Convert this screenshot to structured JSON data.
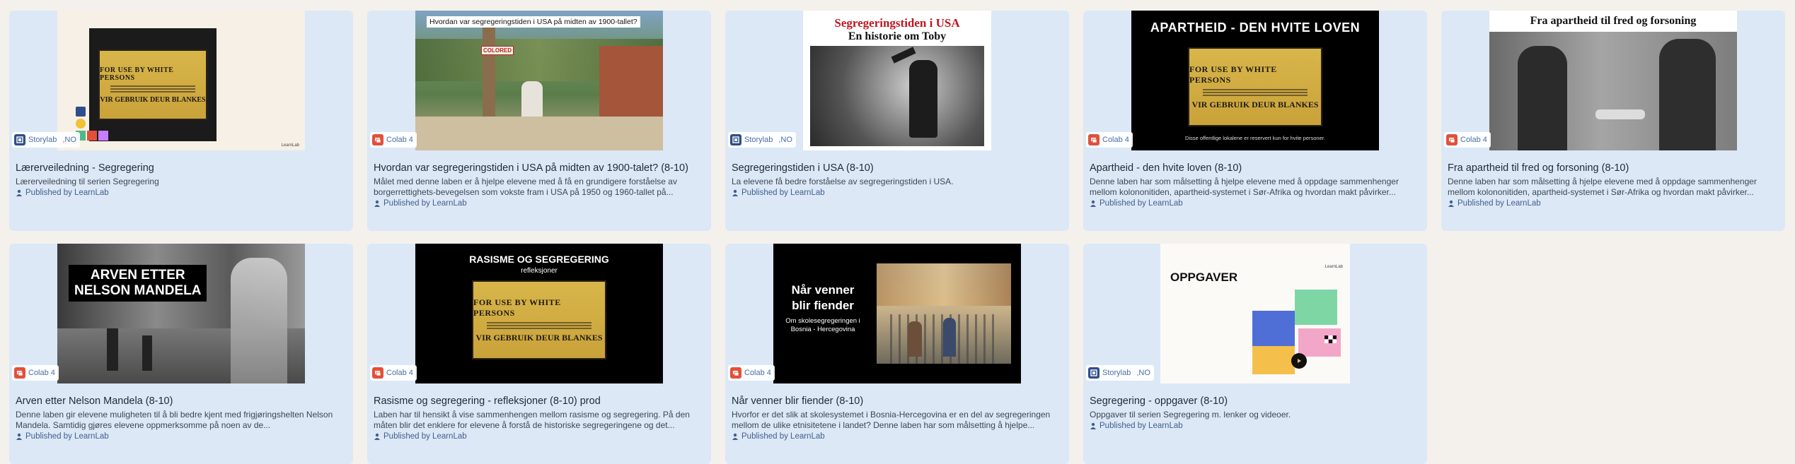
{
  "cards": [
    {
      "title": "Lærerveiledning - Segregering",
      "desc": "Lærerveiledning til serien Segregering",
      "publisher": "Published by LearnLab",
      "badge": "Storylab",
      "badge_lang": ",NO",
      "thumb": {
        "sign_top": "FOR USE BY WHITE PERSONS",
        "sign_bottom": "VIR GEBRUIK DEUR BLANKES",
        "corner": "LearnLab"
      }
    },
    {
      "title": "Hvordan var segregeringstiden i USA på midten av 1900-talet? (8-10)",
      "desc": "Målet med denne laben er å hjelpe elevene med å få en grundigere forståelse av borgerrettighets-bevegelsen som vokste fram i USA på 1950 og 1960-tallet på...",
      "publisher": "Published by LearnLab",
      "badge": "Colab 4",
      "thumb": {
        "caption": "Hvordan var segregeringstiden i USA på midten av 1900-tallet?",
        "sign": "COLORED"
      }
    },
    {
      "title": "Segregeringstiden i USA (8-10)",
      "desc": "La elevene få bedre forståelse av segregeringstiden i USA.",
      "publisher": "Published by LearnLab",
      "badge": "Storylab",
      "badge_lang": ",NO",
      "thumb": {
        "line1": "Segregeringstiden i USA",
        "line2": "En historie om Toby"
      }
    },
    {
      "title": "Apartheid - den hvite loven (8-10)",
      "desc": "Denne laben har som målsetting å hjelpe elevene med å oppdage sammenhenger mellom kolononitiden, apartheid-systemet i Sør-Afrika og hvordan makt påvirker...",
      "publisher": "Published by LearnLab",
      "badge": "Colab 4",
      "thumb": {
        "heading": "APARTHEID - DEN HVITE LOVEN",
        "sign_top": "FOR USE BY WHITE PERSONS",
        "sign_bottom": "VIR GEBRUIK DEUR BLANKES",
        "caption": "Disse offentlige lokalene er reservert kun for hvite personer."
      }
    },
    {
      "title": "Fra apartheid til fred og forsoning (8-10)",
      "desc": "Denne laben har som målsetting å hjelpe elevene med å oppdage sammenhenger mellom kolononitiden, apartheid-systemet i Sør-Afrika og hvordan makt påvirker...",
      "publisher": "Published by LearnLab",
      "badge": "Colab 4",
      "thumb": {
        "heading": "Fra apartheid til fred og forsoning"
      }
    },
    {
      "title": "Arven etter Nelson Mandela (8-10)",
      "desc": "Denne laben gir elevene muligheten til å bli bedre kjent med frigjøringshelten Nelson Mandela. Samtidig gjøres elevene oppmerksomme på noen av de...",
      "publisher": "Published by LearnLab",
      "badge": "Colab 4",
      "thumb": {
        "line1": "ARVEN ETTER",
        "line2": "NELSON MANDELA"
      }
    },
    {
      "title": "Rasisme og segregering - refleksjoner (8-10) prod",
      "desc": "Laben har til hensikt å vise sammenhengen mellom rasisme og segregering. På den måten blir det enklere for elevene å forstå de historiske segregeringene og det...",
      "publisher": "Published by LearnLab",
      "badge": "Colab 4",
      "thumb": {
        "heading": "RASISME OG SEGREGERING",
        "sub": "refleksjoner",
        "sign_top": "FOR USE BY WHITE PERSONS",
        "sign_bottom": "VIR GEBRUIK DEUR BLANKES"
      }
    },
    {
      "title": "Når venner blir fiender (8-10)",
      "desc": "Hvorfor er det slik at skolesystemet i Bosnia-Hercegovina er en del av segregeringen mellom de ulike etnisitetene i landet? Denne laben har som målsetting å hjelpe...",
      "publisher": "Published by LearnLab",
      "badge": "Colab 4",
      "thumb": {
        "line1": "Når venner",
        "line2": "blir fiender",
        "sub": "Om skolesegregeringen i Bosnia - Hercegovina"
      }
    },
    {
      "title": "Segregering - oppgaver (8-10)",
      "desc": "Oppgaver til serien Segregering m. lenker og videoer.",
      "publisher": "Published by LearnLab",
      "badge": "Storylab",
      "badge_lang": ",NO",
      "thumb": {
        "heading": "OPPGAVER",
        "corner": "LearnLab"
      }
    }
  ],
  "colors": {
    "card_bg": "#dce8f6",
    "page_bg": "#f4f1ec",
    "link": "#3f5f8f",
    "storylab": "#2f4d8a",
    "colab": "#e2503a"
  }
}
